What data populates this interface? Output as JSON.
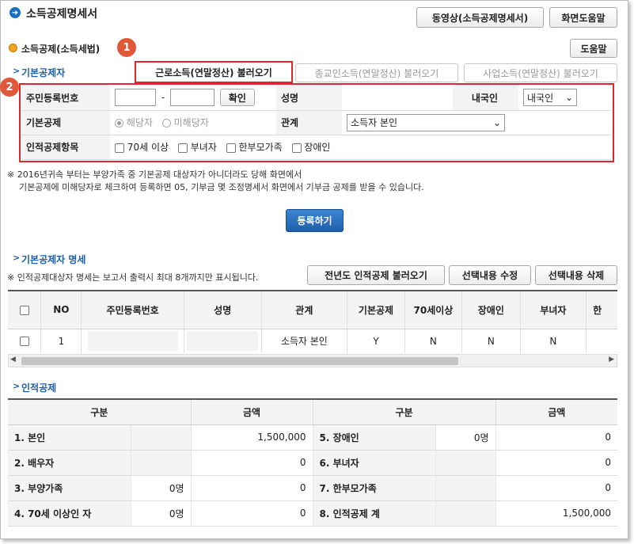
{
  "page": {
    "title": "소득공제명세서",
    "top_buttons": {
      "video": "동영상(소득공제명세서)",
      "help": "화면도움말"
    }
  },
  "section": {
    "title": "소득공제(소득세법)",
    "help_button": "도움말",
    "badge1": "1",
    "badge2": "2"
  },
  "basic": {
    "title": "기본공제자",
    "load_buttons": [
      "근로소득(연말정산) 불러오기",
      "종교인소득(연말정산) 불러오기",
      "사업소득(연말정산) 불러오기"
    ]
  },
  "form": {
    "rrn_label": "주민등록번호",
    "rrn_dash": "-",
    "confirm_button": "확인",
    "name_label": "성명",
    "nation_label": "내국인",
    "nation_value": "내국인",
    "basic_label": "기본공제",
    "basic_options": [
      "해당자",
      "미해당자"
    ],
    "relation_label": "관계",
    "relation_value": "소득자 본인",
    "personal_label": "인적공제항목",
    "personal_options": [
      "70세 이상",
      "부녀자",
      "한부모가족",
      "장애인"
    ]
  },
  "notes": [
    "※ 2016년귀속 부터는 부양가족 중 기본공제 대상자가 아니더라도 당해 화면에서",
    "기본공제에 미해당자로 체크하여 등록하면 05, 기부금 몇 조정명세서 화면에서 기부금 공제를 받을 수 있습니다."
  ],
  "register_button": "등록하기",
  "detail": {
    "title": "기본공제자 명세",
    "note": "※ 인적공제대상자 명세는 보고서 출력시 최대 8개까지만 표시됩니다.",
    "buttons": [
      "전년도 인적공제 불러오기",
      "선택내용 수정",
      "선택내용 삭제"
    ],
    "columns": [
      "NO",
      "주민등록번호",
      "성명",
      "관계",
      "기본공제",
      "70세이상",
      "장애인",
      "부녀자",
      "한"
    ],
    "rows": [
      {
        "no": "1",
        "rrn": "",
        "name": "",
        "relation": "소득자 본인",
        "basic": "Y",
        "senior": "N",
        "disabled": "N",
        "woman": "N"
      }
    ]
  },
  "personal": {
    "title": "인적공제",
    "headers": [
      "구분",
      "금액",
      "구분",
      "금액"
    ],
    "rows": [
      {
        "left_label": "1. 본인",
        "left_count": "",
        "left_amount": "1,500,000",
        "right_label": "5. 장애인",
        "right_count": "0명",
        "right_amount": "0"
      },
      {
        "left_label": "2. 배우자",
        "left_count": "",
        "left_amount": "0",
        "right_label": "6. 부녀자",
        "right_count": "",
        "right_amount": "0"
      },
      {
        "left_label": "3. 부양가족",
        "left_count": "0명",
        "left_amount": "0",
        "right_label": "7. 한부모가족",
        "right_count": "",
        "right_amount": "0"
      },
      {
        "left_label": "4. 70세 이상인 자",
        "left_count": "0명",
        "left_amount": "0",
        "right_label": "8. 인적공제 계",
        "right_count": "",
        "right_amount": "1,500,000"
      }
    ]
  },
  "colors": {
    "accent_blue": "#1b5fa8",
    "highlight_red": "#e3262e",
    "badge_orange": "#e0583a"
  }
}
